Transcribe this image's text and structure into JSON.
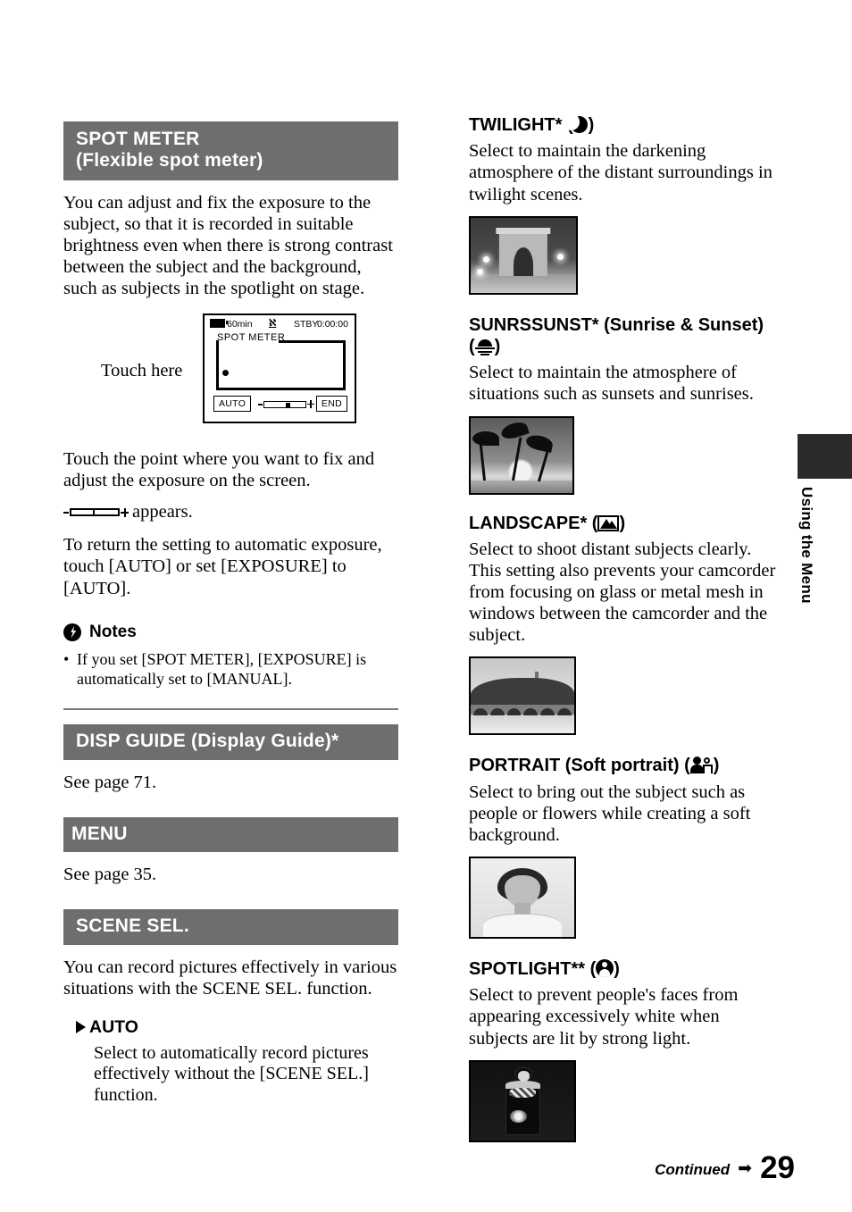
{
  "page": {
    "number": "29",
    "continued_label": "Continued",
    "continued_arrow": "➡",
    "side_tab_label": "Using the Menu"
  },
  "left_column": {
    "spot_meter": {
      "heading_line1": "SPOT METER",
      "heading_line2": "(Flexible spot meter)",
      "body": "You can adjust and fix the exposure to the subject, so that it is recorded in suitable brightness even when there is strong contrast between the subject and the background, such as subjects in the spotlight on stage.",
      "diagram": {
        "touch_label": "Touch here",
        "lcd": {
          "battery_time": "60min",
          "tape_icon": "tape-icon",
          "status": "STBY",
          "timecode": "0:00:00",
          "mode_label": "SPOT METER",
          "auto_button": "AUTO",
          "end_button": "END"
        }
      },
      "instruction": "Touch the point where you want to fix and adjust the exposure on the screen.",
      "appears_text": "appears.",
      "return_text": "To return the setting to automatic exposure, touch [AUTO] or set [EXPOSURE] to [AUTO].",
      "notes_heading": "Notes",
      "notes": [
        "If you set [SPOT METER], [EXPOSURE] is automatically set to [MANUAL]."
      ]
    },
    "disp_guide": {
      "heading": "DISP GUIDE (Display Guide)*",
      "body": "See page 71."
    },
    "menu": {
      "heading": "MENU",
      "body": "See page 35."
    },
    "scene_sel": {
      "heading": "SCENE SEL.",
      "body": "You can record pictures effectively in various situations with the SCENE SEL. function.",
      "auto": {
        "title": "AUTO",
        "body": "Select to automatically record pictures effectively without the [SCENE SEL.] function."
      }
    }
  },
  "right_column": {
    "scenes": [
      {
        "title": "TWILIGHT* (",
        "title_end": ")",
        "icon": "moon-icon",
        "desc": "Select to maintain the darkening atmosphere of the distant surroundings in twilight scenes.",
        "photo_caption": "arc-de-triomphe-at-night-photo"
      },
      {
        "title": "SUNRSSUNST* (Sunrise & Sunset)",
        "title_line2_open": "(",
        "title_end": ")",
        "icon": "sunset-icon",
        "desc": "Select to maintain the atmosphere of situations such as sunsets and sunrises.",
        "photo_caption": "palm-trees-sunset-photo"
      },
      {
        "title": "LANDSCAPE* (",
        "title_end": ")",
        "icon": "landscape-icon",
        "desc": "Select to shoot distant subjects clearly. This setting also prevents your camcorder from focusing on glass or metal mesh in windows between the camcorder and the subject.",
        "photo_caption": "bridge-landscape-photo"
      },
      {
        "title": "PORTRAIT (Soft portrait) (",
        "title_end": ")",
        "icon": "portrait-icon",
        "desc": "Select to bring out the subject such as people or flowers while creating a soft background.",
        "photo_caption": "person-portrait-photo"
      },
      {
        "title": "SPOTLIGHT** (",
        "title_end": ")",
        "icon": "spotlight-icon",
        "desc": "Select to prevent people's faces from appearing excessively white when subjects are lit by strong light.",
        "photo_caption": "woman-in-spotlight-photo"
      }
    ]
  },
  "colors": {
    "header_gray": "#6e6e6e",
    "side_tab_dark": "#2b2b2b",
    "rule_gray": "#777777"
  }
}
